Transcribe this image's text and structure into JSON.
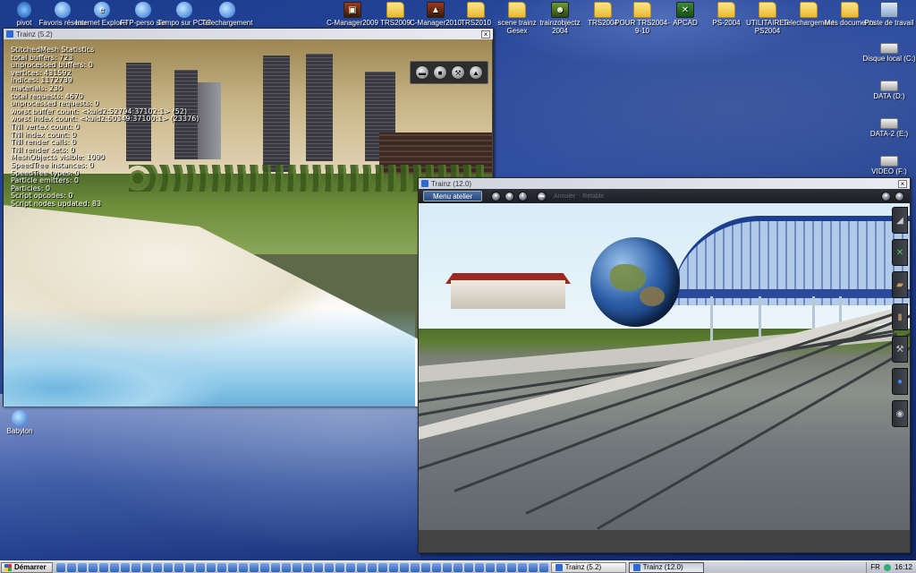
{
  "desktop_icons_top": [
    {
      "label": "pivot",
      "kind": "pivot"
    },
    {
      "label": "Favoris réseau",
      "kind": "web"
    },
    {
      "label": "Internet Explorer",
      "kind": "web"
    },
    {
      "label": "FTP-perso sur PC03 (Acer)",
      "kind": "web"
    },
    {
      "label": "Tempo sur PC02 (Acer)",
      "kind": "web"
    },
    {
      "label": "Telechargement sur PC02 (Acer)",
      "kind": "web"
    },
    {
      "label": "C-Manager2009",
      "kind": "app"
    },
    {
      "label": "TRS2009",
      "kind": "folder"
    },
    {
      "label": "C-Manager2010",
      "kind": "app"
    },
    {
      "label": "TRS2010",
      "kind": "folder"
    },
    {
      "label": "scene trainz Gesex",
      "kind": "folder"
    },
    {
      "label": "trainzobjectz 2004",
      "kind": "app"
    },
    {
      "label": "TRS2004",
      "kind": "folder"
    },
    {
      "label": "POUR TRS2004-9-10",
      "kind": "folder"
    },
    {
      "label": "APCAD",
      "kind": "app"
    },
    {
      "label": "PS-2004",
      "kind": "folder"
    },
    {
      "label": "UTILITAIRES PS2004",
      "kind": "folder"
    },
    {
      "label": "Telechargement",
      "kind": "folder"
    },
    {
      "label": "Mes documents",
      "kind": "folder"
    },
    {
      "label": "Poste de travail",
      "kind": "computer"
    }
  ],
  "desktop_icons_right": [
    {
      "label": "Disque local (C:)"
    },
    {
      "label": "DATA (D:)"
    },
    {
      "label": "DATA-2 (E:)"
    },
    {
      "label": "VIDEO (F:)"
    }
  ],
  "desktop_icon_left": {
    "label": "Babylon"
  },
  "window1": {
    "title": "Trainz  (5.2)",
    "close": "×",
    "stats": [
      "StitchedMesh Statistics",
      "total buffers: 723",
      "unprocessed buffers: 0",
      "vertices: 431592",
      "indices: 1172739",
      "materials: 230",
      "total requests: 4670",
      "unprocessed requests: 0",
      "worst buffer count: <kuid2:52794:37102:1> (52)",
      "worst index count: <kuid2:60349:37100:1> (23376)",
      "TNI vertex count: 0",
      "TNI index count: 0",
      "TNI render calls: 0",
      "TNI render sets: 0",
      "MeshObjects visible: 1090",
      "SpeedTree instances: 0",
      "SpeedTree types: 0",
      "Particle emitters: 0",
      "Particles: 0",
      "Script opcodes: 0",
      "Script nodes updated: 83"
    ]
  },
  "window2": {
    "title": "Trainz  (12.0)",
    "close": "×",
    "menu_button": "Menu atelier",
    "disabled_1": "Annuler",
    "disabled_2": "Rétablir"
  },
  "taskbar": {
    "start": "Démarrer",
    "tasks": [
      "Trainz  (5.2)",
      "Trainz  (12.0)"
    ],
    "lang": "FR",
    "clock": "16:12"
  }
}
